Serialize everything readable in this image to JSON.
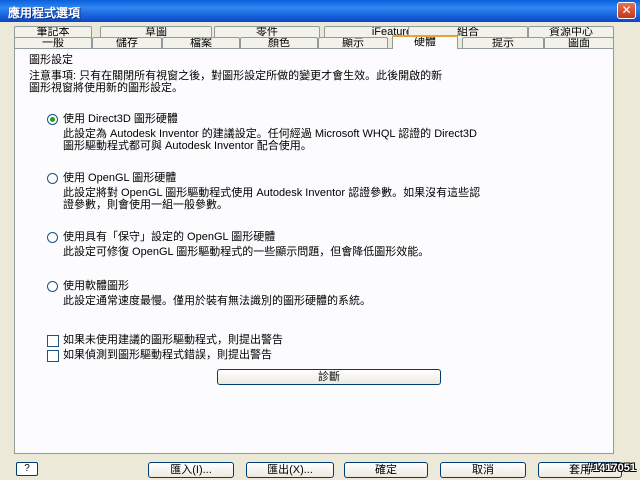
{
  "window": {
    "title": "應用程式選項",
    "close_glyph": "✕"
  },
  "tabs_back": [
    "筆記本",
    "草圖",
    "零件",
    "iFeature",
    "組合",
    "資源中心"
  ],
  "tabs_front": [
    "一般",
    "儲存",
    "檔案",
    "顏色",
    "顯示",
    "硬體",
    "提示",
    "圖面"
  ],
  "panel": {
    "heading": "圖形設定",
    "note_line1": "注意事項: 只有在關閉所有視窗之後，對圖形設定所做的變更才會生效。此後開啟的新",
    "note_line2": "圖形視窗將使用新的圖形設定。",
    "options": [
      {
        "label": "使用 Direct3D 圖形硬體",
        "selected": true,
        "desc1": "此設定為 Autodesk Inventor 的建議設定。任何經過 Microsoft WHQL 認證的 Direct3D",
        "desc2": "圖形驅動程式都可與 Autodesk Inventor 配合使用。"
      },
      {
        "label": "使用 OpenGL 圖形硬體",
        "selected": false,
        "desc1": "此設定將對 OpenGL 圖形驅動程式使用 Autodesk Inventor 認證參數。如果沒有這些認",
        "desc2": "證參數，則會使用一組一般參數。"
      },
      {
        "label": "使用具有「保守」設定的 OpenGL 圖形硬體",
        "selected": false,
        "desc1": "此設定可修復 OpenGL 圖形驅動程式的一些顯示問題，但會降低圖形效能。",
        "desc2": ""
      },
      {
        "label": "使用軟體圖形",
        "selected": false,
        "desc1": "此設定通常速度最慢。僅用於裝有無法識別的圖形硬體的系統。",
        "desc2": ""
      }
    ],
    "checkbox1": "如果未使用建議的圖形驅動程式，則提出警告",
    "checkbox2": "如果偵測到圖形驅動程式錯誤，則提出警告",
    "diagnose_button": "診斷"
  },
  "footer": {
    "help_glyph": "?",
    "import_button": "匯入(I)...",
    "export_button": "匯出(X)...",
    "ok_button": "確定",
    "cancel_button": "取消",
    "apply_button": "套用",
    "watermark": "#1417051"
  },
  "colors": {
    "titlebar": "#0a5fd8",
    "radio_dot": "#21a121",
    "active_tab_accent": "#e6a23c"
  }
}
